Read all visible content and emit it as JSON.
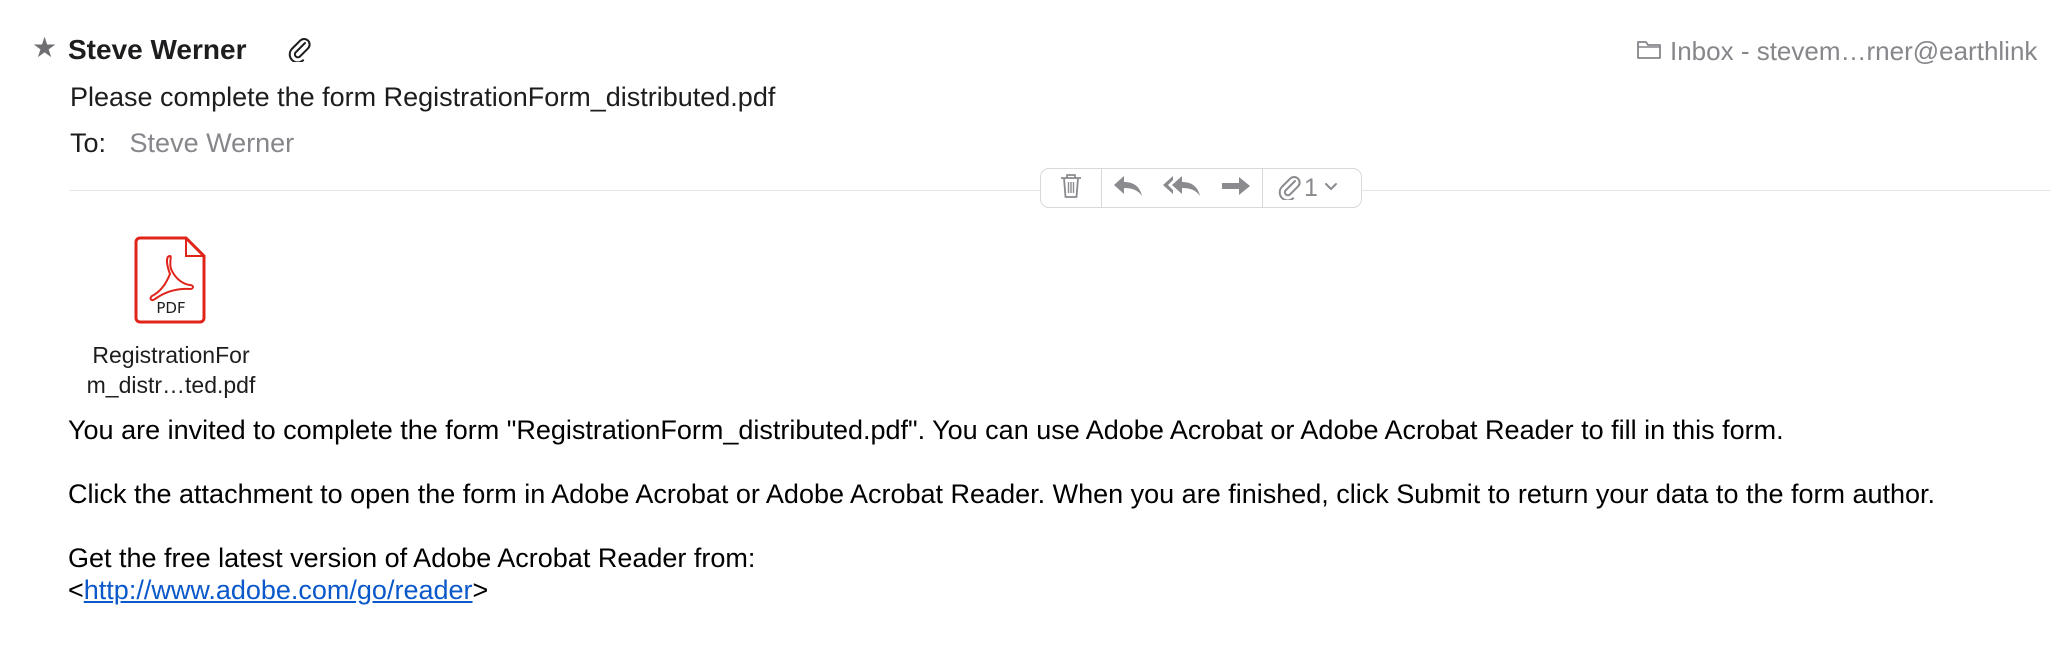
{
  "header": {
    "star_glyph": "★",
    "sender_name": "Steve Werner",
    "mailbox_label": "Inbox - stevem…rner@earthlink",
    "subject": "Please complete the form RegistrationForm_distributed.pdf",
    "to_label": "To:",
    "to_value": "Steve Werner"
  },
  "toolbar": {
    "icons": [
      "trash-icon",
      "reply-icon",
      "reply-all-icon",
      "forward-icon",
      "paperclip-icon",
      "chevron-down-icon"
    ],
    "attachment_count": "1"
  },
  "attachment": {
    "icon_label": "PDF",
    "file_name_line1": "RegistrationFor",
    "file_name_line2": "m_distr…ted.pdf"
  },
  "body": {
    "paragraph1": "You are invited to complete the form \"RegistrationForm_distributed.pdf\". You can use Adobe Acrobat or Adobe Acrobat Reader to fill in this form.",
    "paragraph2": "Click the attachment to open the form in Adobe Acrobat or Adobe Acrobat Reader. When you are finished, click Submit to return your data to the form author.",
    "paragraph3_line1": "Get the free latest version of Adobe Acrobat Reader from:",
    "link_open": "<",
    "link_text": "http://www.adobe.com/go/reader",
    "link_close": ">"
  },
  "colors": {
    "link": "#0a58ca",
    "pdf_red": "#e0241a",
    "muted_text": "#86868b",
    "icon_gray": "#8a8a8f"
  }
}
